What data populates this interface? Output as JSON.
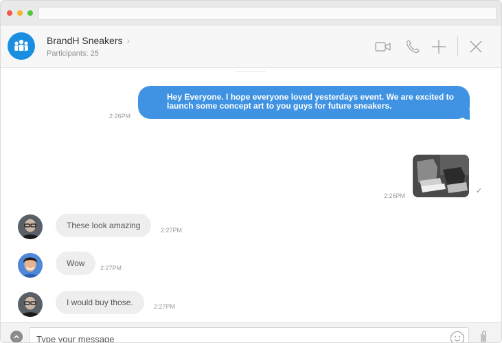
{
  "header": {
    "title": "BrandH Sneakers",
    "chevron": "›",
    "participants": "Participants: 25",
    "icons": [
      "video-call-icon",
      "phone-call-icon",
      "add-icon",
      "close-icon"
    ]
  },
  "messages": {
    "outgoing_text": "Hey Everyone. I hope everyone loved yesterdays event. We are excited to launch some concept art to you guys for future sneakers.",
    "outgoing_time": "2:26PM",
    "photo_time": "2:26PM",
    "photo_status": "✓",
    "incoming": [
      {
        "text": "These look amazing",
        "time": "2:27PM"
      },
      {
        "text": "Wow",
        "time": "2:27PM"
      },
      {
        "text": "I would buy those.",
        "time": "2:27PM"
      }
    ]
  },
  "composer": {
    "placeholder": "Type your message"
  },
  "colors": {
    "accent": "#3f93e2",
    "group_avatar": "#1a8ee0",
    "incoming_bubble": "#eeeeee"
  }
}
